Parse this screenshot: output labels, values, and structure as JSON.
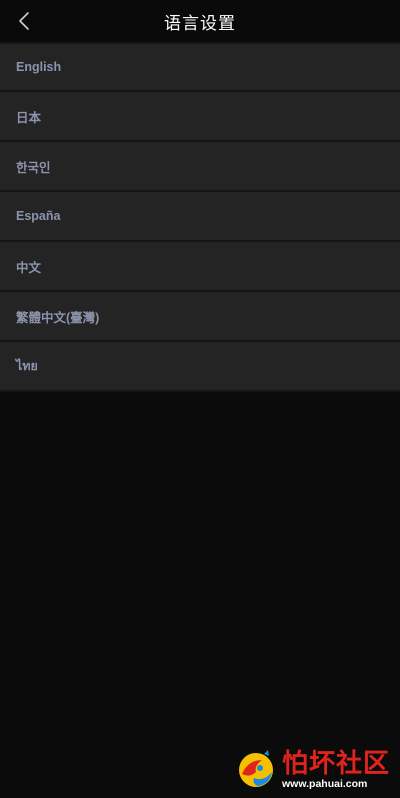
{
  "header": {
    "title": "语言设置",
    "back_icon": "chevron-left-icon"
  },
  "languages": [
    {
      "label": "English"
    },
    {
      "label": "日本"
    },
    {
      "label": "한국인"
    },
    {
      "label": "España"
    },
    {
      "label": "中文"
    },
    {
      "label": "繁體中文(臺灣)"
    },
    {
      "label": "ไทย"
    }
  ],
  "watermark": {
    "title": "怕坏社区",
    "url": "www.pahuai.com"
  },
  "colors": {
    "background": "#0b0b0b",
    "list_item_bg": "#242424",
    "list_label": "#8c93ad",
    "watermark_red": "#e0241b"
  }
}
